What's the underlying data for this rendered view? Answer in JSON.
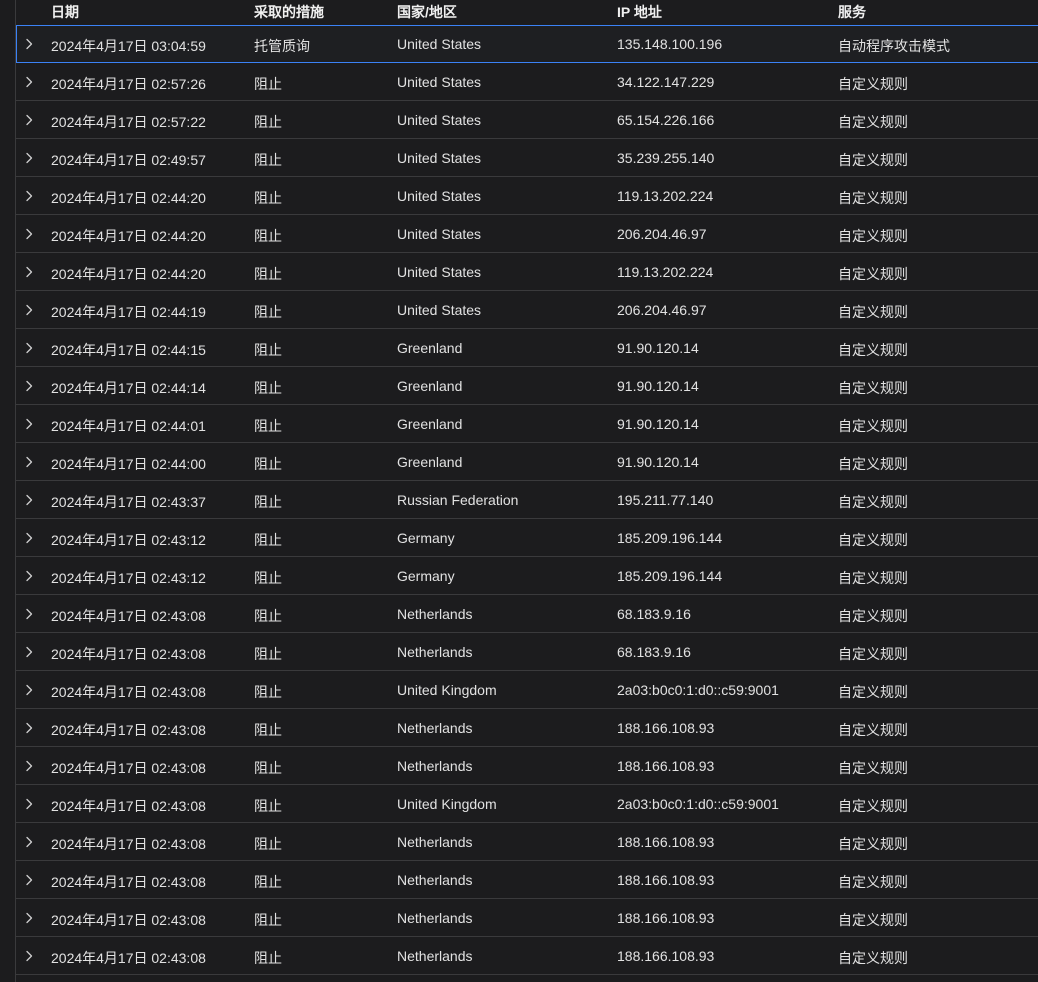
{
  "columns": {
    "date": "日期",
    "action": "采取的措施",
    "country": "国家/地区",
    "ip": "IP 地址",
    "service": "服务"
  },
  "colors": {
    "background": "#1c1c1e",
    "divider": "#3a3a3c",
    "selected_outline": "#3b82f6"
  },
  "rows": [
    {
      "date": "2024年4月17日 03:04:59",
      "action": "托管质询",
      "country": "United States",
      "ip": "135.148.100.196",
      "service": "自动程序攻击模式"
    },
    {
      "date": "2024年4月17日 02:57:26",
      "action": "阻止",
      "country": "United States",
      "ip": "34.122.147.229",
      "service": "自定义规则"
    },
    {
      "date": "2024年4月17日 02:57:22",
      "action": "阻止",
      "country": "United States",
      "ip": "65.154.226.166",
      "service": "自定义规则"
    },
    {
      "date": "2024年4月17日 02:49:57",
      "action": "阻止",
      "country": "United States",
      "ip": "35.239.255.140",
      "service": "自定义规则"
    },
    {
      "date": "2024年4月17日 02:44:20",
      "action": "阻止",
      "country": "United States",
      "ip": "119.13.202.224",
      "service": "自定义规则"
    },
    {
      "date": "2024年4月17日 02:44:20",
      "action": "阻止",
      "country": "United States",
      "ip": "206.204.46.97",
      "service": "自定义规则"
    },
    {
      "date": "2024年4月17日 02:44:20",
      "action": "阻止",
      "country": "United States",
      "ip": "119.13.202.224",
      "service": "自定义规则"
    },
    {
      "date": "2024年4月17日 02:44:19",
      "action": "阻止",
      "country": "United States",
      "ip": "206.204.46.97",
      "service": "自定义规则"
    },
    {
      "date": "2024年4月17日 02:44:15",
      "action": "阻止",
      "country": "Greenland",
      "ip": "91.90.120.14",
      "service": "自定义规则"
    },
    {
      "date": "2024年4月17日 02:44:14",
      "action": "阻止",
      "country": "Greenland",
      "ip": "91.90.120.14",
      "service": "自定义规则"
    },
    {
      "date": "2024年4月17日 02:44:01",
      "action": "阻止",
      "country": "Greenland",
      "ip": "91.90.120.14",
      "service": "自定义规则"
    },
    {
      "date": "2024年4月17日 02:44:00",
      "action": "阻止",
      "country": "Greenland",
      "ip": "91.90.120.14",
      "service": "自定义规则"
    },
    {
      "date": "2024年4月17日 02:43:37",
      "action": "阻止",
      "country": "Russian Federation",
      "ip": "195.211.77.140",
      "service": "自定义规则"
    },
    {
      "date": "2024年4月17日 02:43:12",
      "action": "阻止",
      "country": "Germany",
      "ip": "185.209.196.144",
      "service": "自定义规则"
    },
    {
      "date": "2024年4月17日 02:43:12",
      "action": "阻止",
      "country": "Germany",
      "ip": "185.209.196.144",
      "service": "自定义规则"
    },
    {
      "date": "2024年4月17日 02:43:08",
      "action": "阻止",
      "country": "Netherlands",
      "ip": "68.183.9.16",
      "service": "自定义规则"
    },
    {
      "date": "2024年4月17日 02:43:08",
      "action": "阻止",
      "country": "Netherlands",
      "ip": "68.183.9.16",
      "service": "自定义规则"
    },
    {
      "date": "2024年4月17日 02:43:08",
      "action": "阻止",
      "country": "United Kingdom",
      "ip": "2a03:b0c0:1:d0::c59:9001",
      "service": "自定义规则"
    },
    {
      "date": "2024年4月17日 02:43:08",
      "action": "阻止",
      "country": "Netherlands",
      "ip": "188.166.108.93",
      "service": "自定义规则"
    },
    {
      "date": "2024年4月17日 02:43:08",
      "action": "阻止",
      "country": "Netherlands",
      "ip": "188.166.108.93",
      "service": "自定义规则"
    },
    {
      "date": "2024年4月17日 02:43:08",
      "action": "阻止",
      "country": "United Kingdom",
      "ip": "2a03:b0c0:1:d0::c59:9001",
      "service": "自定义规则"
    },
    {
      "date": "2024年4月17日 02:43:08",
      "action": "阻止",
      "country": "Netherlands",
      "ip": "188.166.108.93",
      "service": "自定义规则"
    },
    {
      "date": "2024年4月17日 02:43:08",
      "action": "阻止",
      "country": "Netherlands",
      "ip": "188.166.108.93",
      "service": "自定义规则"
    },
    {
      "date": "2024年4月17日 02:43:08",
      "action": "阻止",
      "country": "Netherlands",
      "ip": "188.166.108.93",
      "service": "自定义规则"
    },
    {
      "date": "2024年4月17日 02:43:08",
      "action": "阻止",
      "country": "Netherlands",
      "ip": "188.166.108.93",
      "service": "自定义规则"
    }
  ]
}
